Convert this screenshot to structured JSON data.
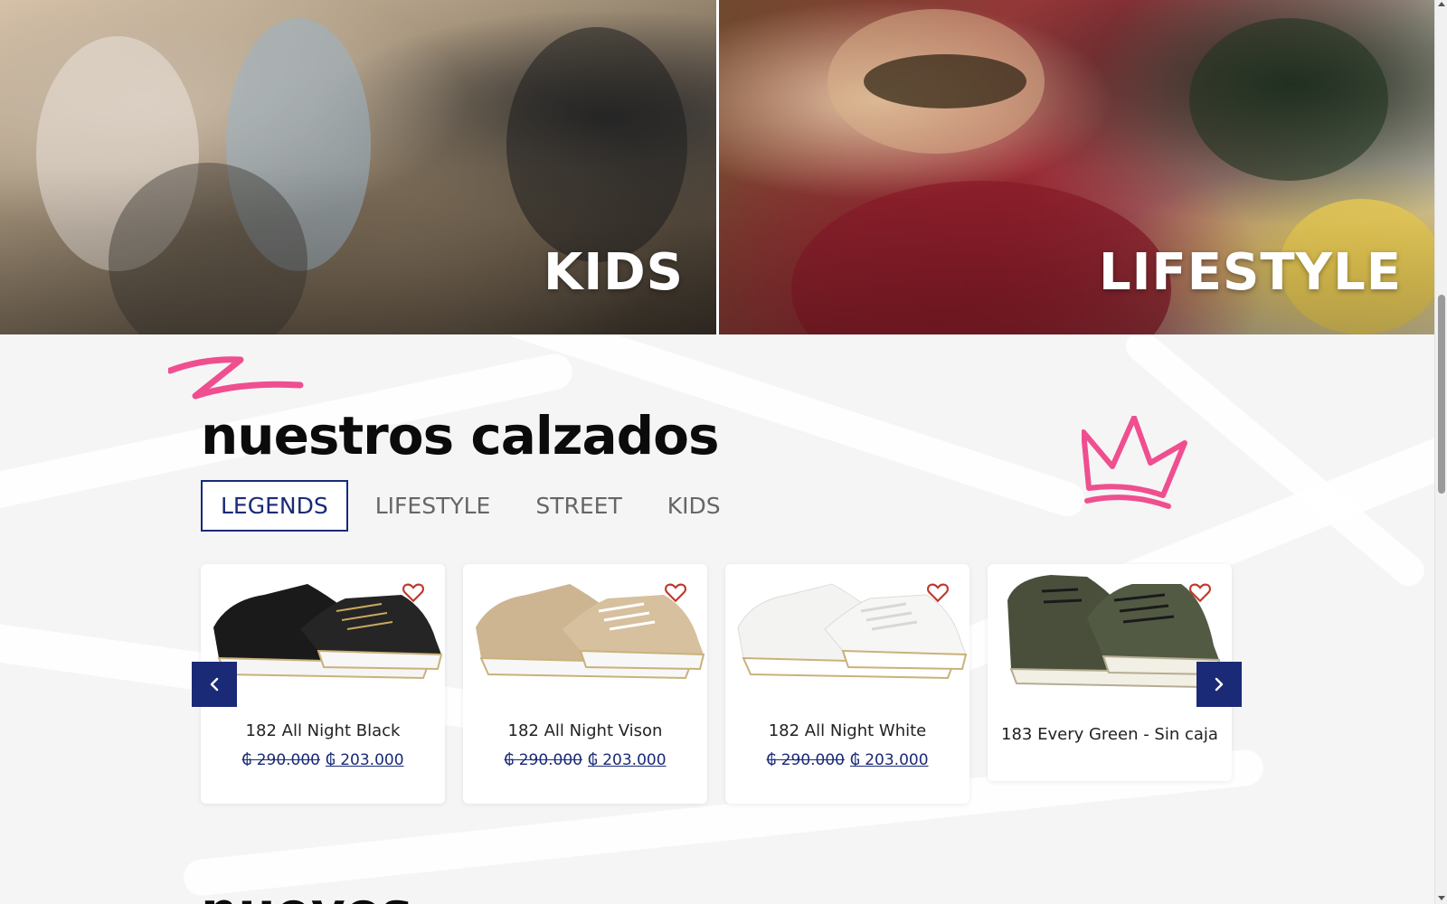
{
  "banners": [
    {
      "label": "KIDS"
    },
    {
      "label": "LIFESTYLE"
    }
  ],
  "section": {
    "title": "nuestros calzados",
    "tabs": [
      {
        "label": "LEGENDS",
        "active": true
      },
      {
        "label": "LIFESTYLE",
        "active": false
      },
      {
        "label": "STREET",
        "active": false
      },
      {
        "label": "KIDS",
        "active": false
      }
    ]
  },
  "products": [
    {
      "name": "182 All Night Black",
      "old_price": "₲ 290.000",
      "new_price": "₲ 203.000",
      "color": "black"
    },
    {
      "name": "182 All Night Vison",
      "old_price": "₲ 290.000",
      "new_price": "₲ 203.000",
      "color": "beige"
    },
    {
      "name": "182 All Night White",
      "old_price": "₲ 290.000",
      "new_price": "₲ 203.000",
      "color": "white"
    },
    {
      "name": "183 Every Green - Sin caja",
      "old_price": "",
      "new_price": "",
      "color": "green"
    }
  ],
  "next_section": {
    "title_partial": "nuevos"
  },
  "colors": {
    "accent": "#1a2a77",
    "pink": "#ef4f8f",
    "heart": "#c0392b"
  }
}
